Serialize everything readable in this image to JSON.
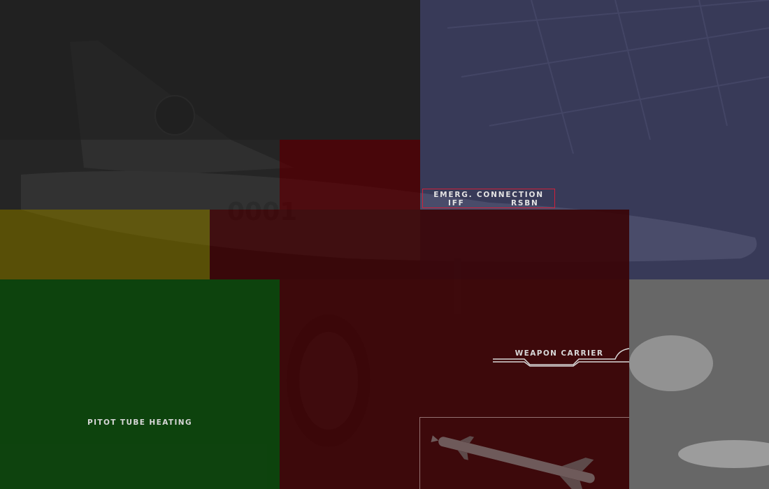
{
  "labels": {
    "emerg_connection": "EMERG. CONNECTION",
    "iff": "IFF",
    "rsbn": "RSBN",
    "weapon_carrier": "WEAPON CARRIER",
    "pitot_tube_heating": "PITOT TUBE HEATING"
  },
  "photo": {
    "tail_number": "0001"
  },
  "colors": {
    "highlight_border": "#d0213a",
    "zone_blue": "#373a64",
    "zone_red": "#4a0206",
    "zone_yellow": "#5c5200",
    "zone_green": "#0a440a",
    "zone_grey": "#8c8c8c"
  }
}
